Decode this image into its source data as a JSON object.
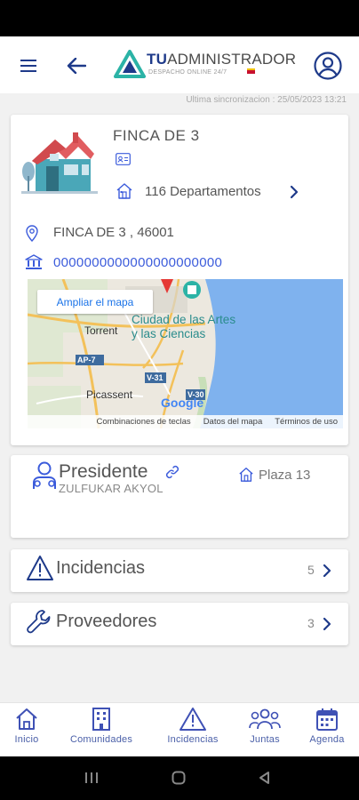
{
  "header": {
    "brand_prefix": "TU",
    "brand_rest": "ADMINISTRADOR",
    "brand_sub": "DESPACHO ONLINE 24/7",
    "menu_icon": "hamburger-menu-icon",
    "back_icon": "arrow-left-icon",
    "profile_icon": "user-circle-icon"
  },
  "sync": "Ultima sincronizacion : 25/05/2023 13:21",
  "finca": {
    "name": "FINCA DE 3",
    "departments": "116 Departamentos",
    "address": "FINCA DE 3 , 46001",
    "iban": "0000000000000000000000"
  },
  "map": {
    "enlarge": "Ampliar el mapa",
    "labels": {
      "city": "Ciudad de las Artes",
      "city2": "y las Ciencias",
      "torrent": "Torrent",
      "picassent": "Picassent",
      "ap7": "AP-7",
      "v31": "V-31",
      "v30": "V-30",
      "google": "Google"
    },
    "attribution": [
      "Combinaciones de teclas",
      "Datos del mapa",
      "Términos de uso"
    ]
  },
  "president": {
    "title": "Presidente",
    "name": "ZULFUKAR AKYOL",
    "plaza": "Plaza 13"
  },
  "rows": [
    {
      "label": "Incidencias",
      "count": "5"
    },
    {
      "label": "Proveedores",
      "count": "3"
    }
  ],
  "bottom_nav": [
    {
      "label": "Inicio",
      "icon": "home-icon"
    },
    {
      "label": "Comunidades",
      "icon": "building-icon"
    },
    {
      "label": "Incidencias",
      "icon": "warning-icon"
    },
    {
      "label": "Juntas",
      "icon": "users-icon"
    },
    {
      "label": "Agenda",
      "icon": "calendar-icon"
    }
  ],
  "colors": {
    "accent": "#1e3a8a",
    "link": "#3b5bdb",
    "teal": "#2bb3a6"
  }
}
